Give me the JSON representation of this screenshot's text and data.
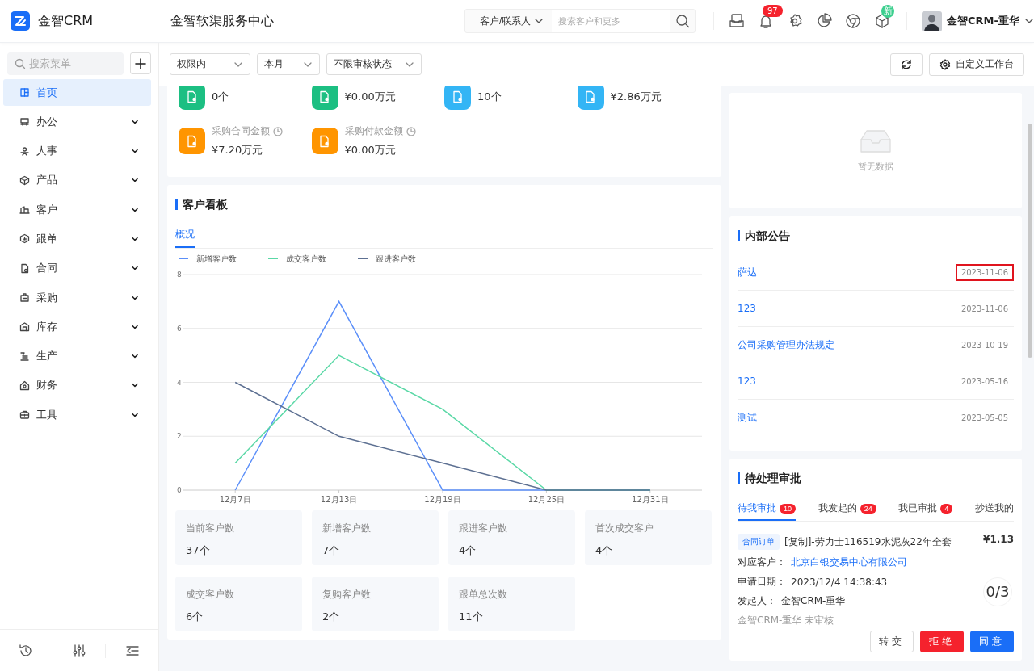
{
  "app": {
    "name": "金智CRM",
    "center_title": "金智软渠服务中心"
  },
  "search": {
    "scope": "客户/联系人",
    "placeholder": "搜索客户和更多"
  },
  "header_badges": {
    "notifications": "97",
    "new": "新"
  },
  "user": {
    "name": "金智CRM-重华"
  },
  "sidebar": {
    "search_placeholder": "搜索菜单",
    "items": [
      {
        "label": "首页",
        "selected": true,
        "expandable": false
      },
      {
        "label": "办公",
        "selected": false,
        "expandable": true
      },
      {
        "label": "人事",
        "selected": false,
        "expandable": true
      },
      {
        "label": "产品",
        "selected": false,
        "expandable": true
      },
      {
        "label": "客户",
        "selected": false,
        "expandable": true
      },
      {
        "label": "跟单",
        "selected": false,
        "expandable": true
      },
      {
        "label": "合同",
        "selected": false,
        "expandable": true
      },
      {
        "label": "采购",
        "selected": false,
        "expandable": true
      },
      {
        "label": "库存",
        "selected": false,
        "expandable": true
      },
      {
        "label": "生产",
        "selected": false,
        "expandable": true
      },
      {
        "label": "财务",
        "selected": false,
        "expandable": true
      },
      {
        "label": "工具",
        "selected": false,
        "expandable": true
      }
    ]
  },
  "filters": [
    {
      "label": "权限内"
    },
    {
      "label": "本月"
    },
    {
      "label": "不限审核状态"
    }
  ],
  "toolbar": {
    "customize_label": "自定义工作台"
  },
  "stats": [
    {
      "value": "0个",
      "color": "#1cbf82"
    },
    {
      "value": "¥0.00万元",
      "color": "#1cbf82"
    },
    {
      "value": "10个",
      "color": "#33b5f5"
    },
    {
      "value": "¥2.86万元",
      "color": "#33b5f5"
    },
    {
      "label": "采购合同金额",
      "value": "¥7.20万元",
      "color": "#ff9500"
    },
    {
      "label": "采购付款金额",
      "value": "¥0.00万元",
      "color": "#ff9500"
    }
  ],
  "customer_board": {
    "title": "客户看板",
    "tabs": [
      {
        "label": "概况",
        "selected": true
      }
    ],
    "chart_data": {
      "type": "line",
      "grid": true,
      "legend": "top",
      "categories": [
        "12月7日",
        "12月13日",
        "12月19日",
        "12月25日",
        "12月31日"
      ],
      "ylim": [
        0,
        8
      ],
      "yticks": [
        0,
        2,
        4,
        6,
        8
      ],
      "series": [
        {
          "name": "新增客户数",
          "color": "#5b8ff9",
          "values": [
            0,
            7,
            0,
            0,
            0
          ]
        },
        {
          "name": "成交客户数",
          "color": "#5ad8a6",
          "values": [
            1,
            5,
            3,
            0,
            0
          ]
        },
        {
          "name": "跟进客户数",
          "color": "#5d7092",
          "values": [
            4,
            2,
            1,
            0,
            0
          ]
        }
      ]
    },
    "metrics": [
      {
        "label": "当前客户数",
        "value": "37个"
      },
      {
        "label": "新增客户数",
        "value": "7个"
      },
      {
        "label": "跟进客户数",
        "value": "4个"
      },
      {
        "label": "首次成交客户",
        "value": "4个"
      },
      {
        "label": "成交客户数",
        "value": "6个"
      },
      {
        "label": "复购客户数",
        "value": "2个"
      },
      {
        "label": "跟单总次数",
        "value": "11个"
      }
    ]
  },
  "empty_panel": {
    "text": "暂无数据"
  },
  "announcements": {
    "title": "内部公告",
    "items": [
      {
        "title": "萨达",
        "date": "2023-11-06",
        "highlighted": true
      },
      {
        "title": "123",
        "date": "2023-11-06",
        "highlighted": false
      },
      {
        "title": "公司采购管理办法规定",
        "date": "2023-10-19",
        "highlighted": false
      },
      {
        "title": "123",
        "date": "2023-05-16",
        "highlighted": false
      },
      {
        "title": "测试",
        "date": "2023-05-05",
        "highlighted": false
      }
    ]
  },
  "approvals": {
    "title": "待处理审批",
    "tabs": [
      {
        "label": "待我审批",
        "count": "10",
        "selected": true
      },
      {
        "label": "我发起的",
        "count": "24",
        "selected": false
      },
      {
        "label": "我已审批",
        "count": "4",
        "selected": false
      },
      {
        "label": "抄送我的",
        "selected": false
      }
    ],
    "item": {
      "tag": "合同订单",
      "title": "[复制]-劳力士116519水泥灰22年全套",
      "amount": "¥1.13",
      "customer_label": "对应客户：",
      "customer": "北京白银交易中心有限公司",
      "date_label": "申请日期：",
      "date": "2023/12/4 14:38:43",
      "initiator_label": "发起人：",
      "initiator": "金智CRM-重华",
      "status": "金智CRM-重华 未审核",
      "progress": "0/3"
    },
    "buttons": [
      {
        "label": "转交",
        "kind": "default"
      },
      {
        "label": "拒绝",
        "kind": "danger"
      },
      {
        "label": "同意",
        "kind": "primary"
      }
    ]
  }
}
